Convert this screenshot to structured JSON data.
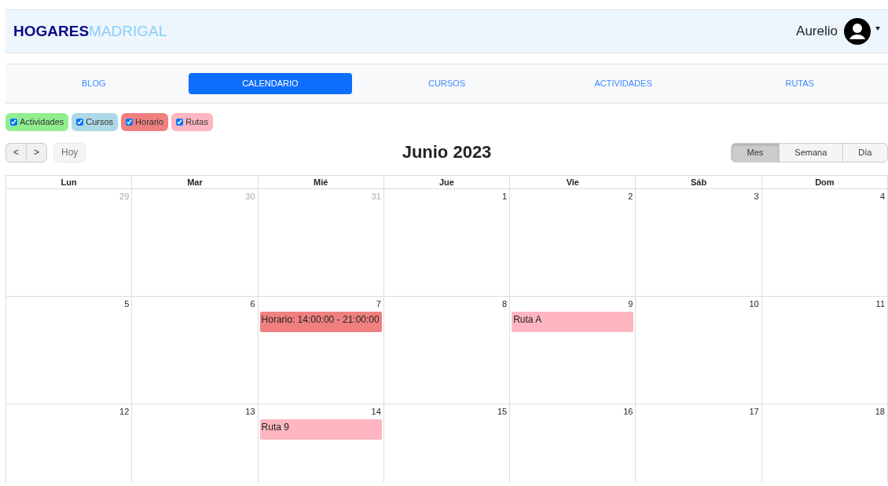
{
  "brand": {
    "primary": "HOGARES",
    "secondary": "MADRIGAL"
  },
  "user": {
    "name": "Aurelio"
  },
  "nav": [
    {
      "label": "BLOG",
      "selected": false
    },
    {
      "label": "CALENDARIO",
      "selected": true
    },
    {
      "label": "CURSOS",
      "selected": false
    },
    {
      "label": "ACTIVIDADES",
      "selected": false
    },
    {
      "label": "RUTAS",
      "selected": false
    }
  ],
  "filters": [
    {
      "label": "Actividades",
      "checked": true,
      "color": "#90ee90"
    },
    {
      "label": "Cursos",
      "checked": true,
      "color": "#add8e6"
    },
    {
      "label": "Horario",
      "checked": true,
      "color": "#f08080"
    },
    {
      "label": "Rutas",
      "checked": true,
      "color": "#ffb6c1"
    }
  ],
  "toolbar": {
    "prev": "<",
    "next": ">",
    "today": "Hoy",
    "title": "Junio 2023",
    "views": [
      {
        "label": "Mes",
        "selected": true
      },
      {
        "label": "Semana",
        "selected": false
      },
      {
        "label": "Día",
        "selected": false
      }
    ]
  },
  "calendar": {
    "weekdays": [
      "Lun",
      "Mar",
      "Mié",
      "Jue",
      "Vie",
      "Sáb",
      "Dom"
    ],
    "weeks": [
      [
        {
          "day": "29",
          "other_month": true
        },
        {
          "day": "30",
          "other_month": true
        },
        {
          "day": "31",
          "other_month": true
        },
        {
          "day": "1",
          "other_month": false
        },
        {
          "day": "2",
          "other_month": false
        },
        {
          "day": "3",
          "other_month": false
        },
        {
          "day": "4",
          "other_month": false
        }
      ],
      [
        {
          "day": "5",
          "other_month": false
        },
        {
          "day": "6",
          "other_month": false
        },
        {
          "day": "7",
          "other_month": false,
          "events": [
            {
              "title": "Horario: 14:00:00 - 21:00:00",
              "color": "#f08080"
            }
          ]
        },
        {
          "day": "8",
          "other_month": false
        },
        {
          "day": "9",
          "other_month": false,
          "events": [
            {
              "title": "Ruta A",
              "color": "#ffb6c1"
            }
          ]
        },
        {
          "day": "10",
          "other_month": false
        },
        {
          "day": "11",
          "other_month": false
        }
      ],
      [
        {
          "day": "12",
          "other_month": false
        },
        {
          "day": "13",
          "other_month": false
        },
        {
          "day": "14",
          "other_month": false,
          "events": [
            {
              "title": "Ruta 9",
              "color": "#ffb6c1"
            }
          ]
        },
        {
          "day": "15",
          "other_month": false
        },
        {
          "day": "16",
          "other_month": false
        },
        {
          "day": "17",
          "other_month": false
        },
        {
          "day": "18",
          "other_month": false
        }
      ]
    ]
  }
}
